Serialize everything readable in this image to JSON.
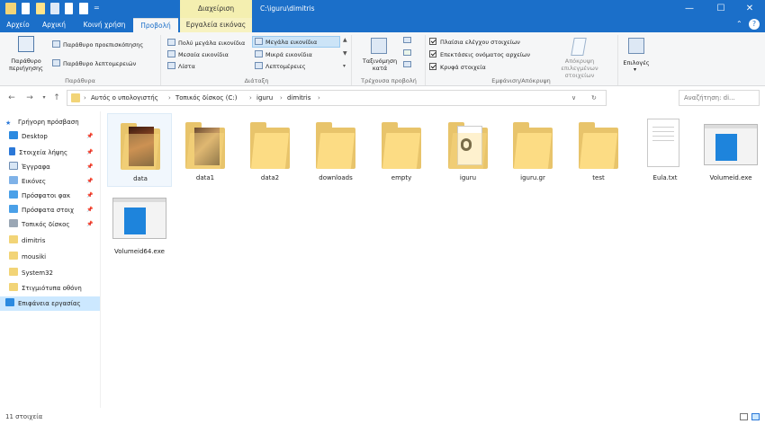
{
  "window": {
    "context_tab_header": "Διαχείριση",
    "title": "C:\\iguru\\dimitris",
    "controls": {
      "minimize": "—",
      "maximize": "☐",
      "close": "✕"
    }
  },
  "tabs": [
    "Αρχείο",
    "Αρχική",
    "Κοινή χρήση",
    "Προβολή",
    "Εργαλεία εικόνας"
  ],
  "ribbon": {
    "panes": {
      "nav_pane_label": "Παράθυρο περιήγησης",
      "preview_pane": "Παράθυρο προεπισκόπησης",
      "details_pane": "Παράθυρο λεπτομερειών",
      "group_label": "Παράθυρα"
    },
    "layout": {
      "col1": [
        "Πολύ μεγάλα εικονίδια",
        "Μεσαία εικονίδια",
        "Λίστα"
      ],
      "col2": [
        "Μεγάλα εικονίδια",
        "Μικρά εικονίδια",
        "Λεπτομέρειες"
      ],
      "group_label": "Διάταξη"
    },
    "current_view": {
      "sort_label": "Ταξινόμηση κατά",
      "group_label": "Τρέχουσα προβολή"
    },
    "show_hide": {
      "checkboxes": [
        "Πλαίσια ελέγχου στοιχείων",
        "Επεκτάσεις ονόματος αρχείων",
        "Κρυφά στοιχεία"
      ],
      "hide_selected": "Απόκρυψη επιλεγμένων στοιχείων",
      "group_label": "Εμφάνιση/Απόκρυψη"
    },
    "options_label": "Επιλογές"
  },
  "address": {
    "crumbs": [
      "Αυτός ο υπολογιστής",
      "Τοπικός δίσκος (C:)",
      "iguru",
      "dimitris"
    ],
    "search_placeholder": "Αναζήτηση: di..."
  },
  "sidebar": {
    "quick_access": "Γρήγορη πρόσβαση",
    "items": [
      "Desktop",
      "Στοιχεία λήψης",
      "Έγγραφα",
      "Εικόνες",
      "Πρόσφατοι φακ",
      "Πρόσφατα στοιχ",
      "Τοπικός δίσκος",
      "dimitris",
      "mousiki",
      "System32",
      "Στιγμιότυπα οθόνη"
    ],
    "desktop_root": "Επιφάνεια εργασίας"
  },
  "files": [
    "data",
    "data1",
    "data2",
    "downloads",
    "empty",
    "iguru",
    "iguru.gr",
    "test",
    "Eula.txt",
    "Volumeid.exe",
    "Volumeid64.exe"
  ],
  "status": {
    "count": "11 στοιχεία"
  },
  "colors": {
    "accent": "#1b6fc9",
    "folder": "#fcdc84",
    "context_tab": "#f4efb0"
  }
}
